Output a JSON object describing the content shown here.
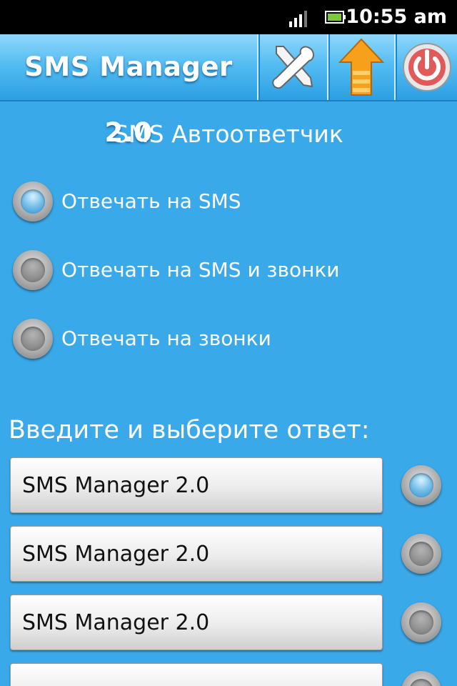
{
  "status_bar": {
    "time": "10:55 am",
    "icons": [
      "signal-icon",
      "battery-icon"
    ]
  },
  "header": {
    "title": "SMS Manager 2.0",
    "buttons": [
      {
        "icon": "wrench-screwdriver-icon"
      },
      {
        "icon": "up-arrow-icon"
      },
      {
        "icon": "power-icon"
      }
    ]
  },
  "autoresponder": {
    "title": "SMS Автоответчик",
    "options": [
      {
        "label": "Отвечать на SMS",
        "checked": true
      },
      {
        "label": "Отвечать на SMS и звонки",
        "checked": false
      },
      {
        "label": "Отвечать на звонки",
        "checked": false
      }
    ]
  },
  "replies": {
    "prompt": "Введите и выберите ответ:",
    "items": [
      {
        "value": "SMS Manager 2.0",
        "selected": true
      },
      {
        "value": "SMS Manager 2.0",
        "selected": false
      },
      {
        "value": "SMS Manager 2.0",
        "selected": false
      },
      {
        "value": "",
        "selected": false
      }
    ]
  },
  "colors": {
    "background": "#3aa9e9",
    "accent_orange": "#f7a01c",
    "power_red": "#e05a5a"
  }
}
